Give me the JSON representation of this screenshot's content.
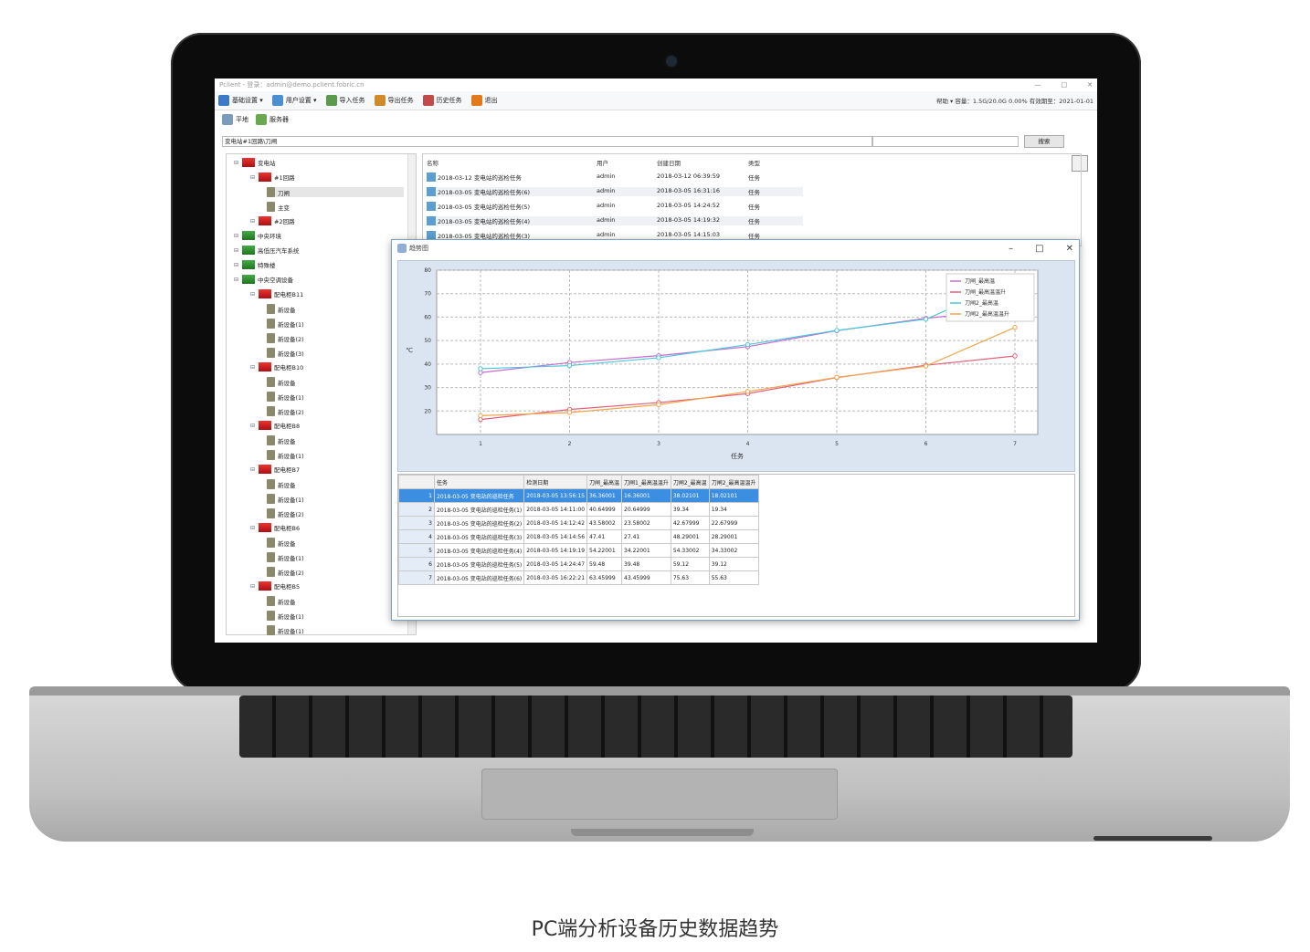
{
  "caption": "PC端分析设备历史数据趋势",
  "app": {
    "title": "Pclient - 登录：admin@demo.pclient.fobric.cn",
    "menu": [
      "基础设置 ▾",
      "用户设置 ▾",
      "导入任务",
      "导出任务",
      "历史任务",
      "退出"
    ],
    "status": "帮助 ▾    容量：1.5G/20.0G 0.00%    有效期至：2021-01-01",
    "tabs": [
      "平地",
      "服务器"
    ],
    "path": "变电站#1回路\\刀闸",
    "search_button": "搜索"
  },
  "tree": [
    {
      "label": "变电站",
      "level": 0,
      "type": "fac"
    },
    {
      "label": "#1回路",
      "level": 1,
      "type": "fac"
    },
    {
      "label": "刀闸",
      "level": 2,
      "type": "dev"
    },
    {
      "label": "主变",
      "level": 2,
      "type": "dev"
    },
    {
      "label": "#2回路",
      "level": 1,
      "type": "fac"
    },
    {
      "label": "中央环境",
      "level": 0,
      "type": "grn"
    },
    {
      "label": "高低压汽车系统",
      "level": 0,
      "type": "grn"
    },
    {
      "label": "特殊楼",
      "level": 0,
      "type": "grn"
    },
    {
      "label": "中央空调设备",
      "level": 0,
      "type": "grn"
    },
    {
      "label": "配电柜B11",
      "level": 1,
      "type": "fac"
    },
    {
      "label": "新设备",
      "level": 2,
      "type": "dev"
    },
    {
      "label": "新设备(1)",
      "level": 2,
      "type": "dev"
    },
    {
      "label": "新设备(2)",
      "level": 2,
      "type": "dev"
    },
    {
      "label": "新设备(3)",
      "level": 2,
      "type": "dev"
    },
    {
      "label": "配电柜B10",
      "level": 1,
      "type": "fac"
    },
    {
      "label": "新设备",
      "level": 2,
      "type": "dev"
    },
    {
      "label": "新设备(1)",
      "level": 2,
      "type": "dev"
    },
    {
      "label": "新设备(2)",
      "level": 2,
      "type": "dev"
    },
    {
      "label": "配电柜B8",
      "level": 1,
      "type": "fac"
    },
    {
      "label": "新设备",
      "level": 2,
      "type": "dev"
    },
    {
      "label": "新设备(1)",
      "level": 2,
      "type": "dev"
    },
    {
      "label": "配电柜B7",
      "level": 1,
      "type": "fac"
    },
    {
      "label": "新设备",
      "level": 2,
      "type": "dev"
    },
    {
      "label": "新设备(1)",
      "level": 2,
      "type": "dev"
    },
    {
      "label": "新设备(2)",
      "level": 2,
      "type": "dev"
    },
    {
      "label": "配电柜B6",
      "level": 1,
      "type": "fac"
    },
    {
      "label": "新设备",
      "level": 2,
      "type": "dev"
    },
    {
      "label": "新设备(1)",
      "level": 2,
      "type": "dev"
    },
    {
      "label": "新设备(2)",
      "level": 2,
      "type": "dev"
    },
    {
      "label": "配电柜B5",
      "level": 1,
      "type": "fac"
    },
    {
      "label": "新设备",
      "level": 2,
      "type": "dev"
    },
    {
      "label": "新设备(1)",
      "level": 2,
      "type": "dev"
    },
    {
      "label": "新设备(1)",
      "level": 2,
      "type": "dev"
    }
  ],
  "tasklist": {
    "headers": [
      "名称",
      "用户",
      "创建日期",
      "类型"
    ],
    "rows": [
      [
        "2018-03-12 变电站的巡检任务",
        "admin",
        "2018-03-12 06:39:59",
        "任务"
      ],
      [
        "2018-03-05 变电站的巡检任务(6)",
        "admin",
        "2018-03-05 16:31:16",
        "任务"
      ],
      [
        "2018-03-05 变电站的巡检任务(5)",
        "admin",
        "2018-03-05 14:24:52",
        "任务"
      ],
      [
        "2018-03-05 变电站的巡检任务(4)",
        "admin",
        "2018-03-05 14:19:32",
        "任务"
      ],
      [
        "2018-03-05 变电站的巡检任务(3)",
        "admin",
        "2018-03-05 14:15:03",
        "任务"
      ]
    ]
  },
  "window": {
    "title": "趋势图"
  },
  "chart_data": {
    "type": "line",
    "xlabel": "任务",
    "ylabel": "℃",
    "x": [
      1,
      2,
      3,
      4,
      5,
      6,
      7
    ],
    "ylim": [
      10,
      80
    ],
    "yticks": [
      20,
      30,
      40,
      50,
      60,
      70,
      80
    ],
    "legend_position": "top-right",
    "series": [
      {
        "name": "刀闸_最高温",
        "color": "#c76ad1",
        "values": [
          36.36,
          40.65,
          43.58,
          47.41,
          54.22,
          59.48,
          63.45
        ]
      },
      {
        "name": "刀闸_最高温温升",
        "color": "#e0607a",
        "values": [
          16.36,
          20.65,
          23.58,
          27.41,
          34.22,
          39.48,
          43.45
        ]
      },
      {
        "name": "刀闸2_最高温",
        "color": "#4bc6d8",
        "values": [
          38.02,
          39.34,
          42.68,
          48.29,
          54.33,
          59.12,
          75.63
        ]
      },
      {
        "name": "刀闸2_最高温温升",
        "color": "#f0a64a",
        "values": [
          18.02,
          19.34,
          22.68,
          28.29,
          34.33,
          39.12,
          55.63
        ]
      }
    ]
  },
  "grid": {
    "headers": [
      "任务",
      "检测日期",
      "刀闸_最高温",
      "刀闸1_最高温温升",
      "刀闸2_最高温",
      "刀闸2_最高温温升"
    ],
    "rows": [
      [
        "1",
        "2018-03-05 变电站的巡检任务",
        "2018-03-05 13:56:15",
        "36.36001",
        "16.36001",
        "38.02101",
        "18.02101"
      ],
      [
        "2",
        "2018-03-05 变电站的巡检任务(1)",
        "2018-03-05 14:11:00",
        "40.64999",
        "20.64999",
        "39.34",
        "19.34"
      ],
      [
        "3",
        "2018-03-05 变电站的巡检任务(2)",
        "2018-03-05 14:12:42",
        "43.58002",
        "23.58002",
        "42.67999",
        "22.67999"
      ],
      [
        "4",
        "2018-03-05 变电站的巡检任务(3)",
        "2018-03-05 14:14:56",
        "47.41",
        "27.41",
        "48.29001",
        "28.29001"
      ],
      [
        "5",
        "2018-03-05 变电站的巡检任务(4)",
        "2018-03-05 14:19:19",
        "54.22001",
        "34.22001",
        "54.33002",
        "34.33002"
      ],
      [
        "6",
        "2018-03-05 变电站的巡检任务(5)",
        "2018-03-05 14:24:47",
        "59.48",
        "39.48",
        "59.12",
        "39.12"
      ],
      [
        "7",
        "2018-03-05 变电站的巡检任务(6)",
        "2018-03-05 16:22:21",
        "63.45999",
        "43.45999",
        "75.63",
        "55.63"
      ]
    ]
  }
}
